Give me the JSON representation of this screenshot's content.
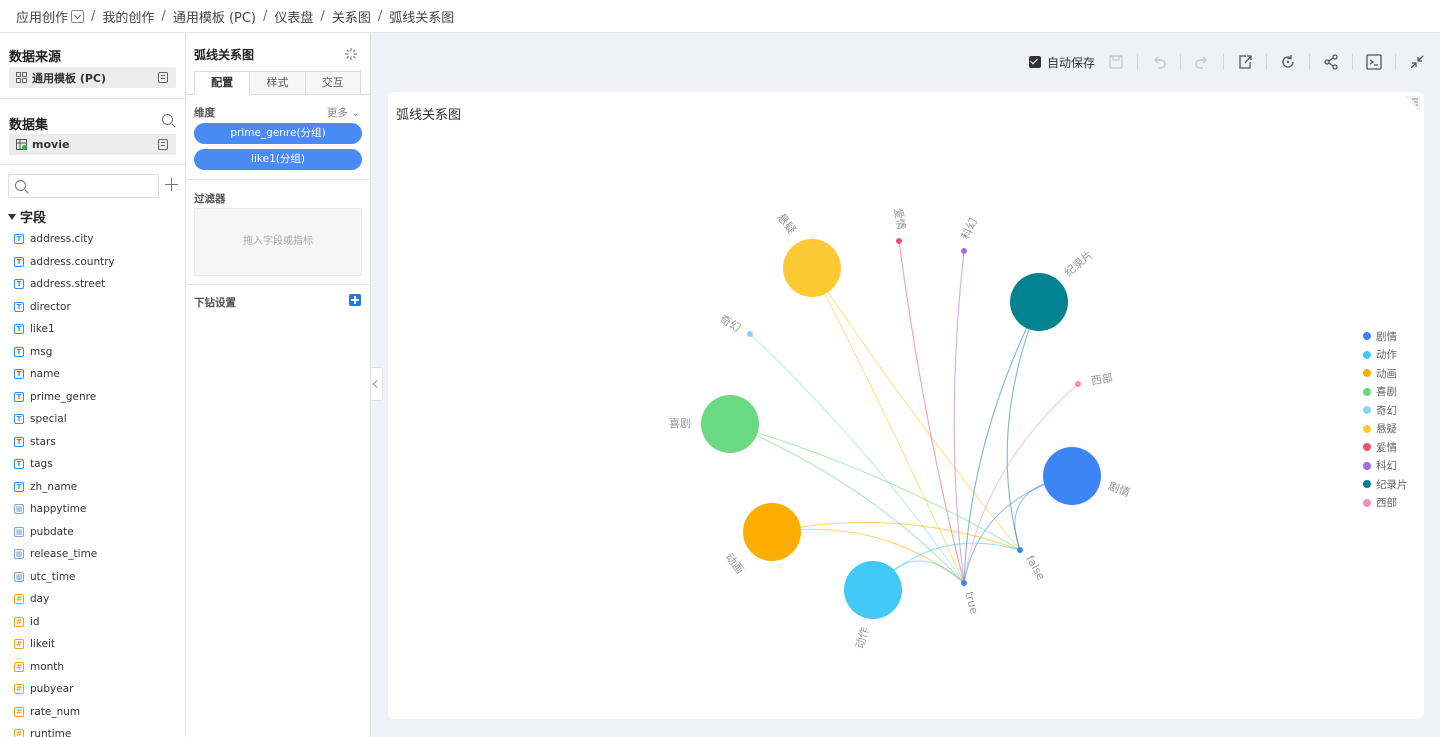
{
  "breadcrumb": {
    "items": [
      "应用创作",
      "我的创作",
      "通用模板 (PC)",
      "仪表盘",
      "关系图",
      "弧线关系图"
    ]
  },
  "left": {
    "datasource_title": "数据来源",
    "datasource_name": "通用模板 (PC)",
    "dataset_title": "数据集",
    "dataset_name": "movie",
    "search_placeholder": "",
    "fields_title": "字段",
    "fields": [
      {
        "name": "address.city",
        "type": "text"
      },
      {
        "name": "address.country",
        "type": "text"
      },
      {
        "name": "address.street",
        "type": "text"
      },
      {
        "name": "director",
        "type": "text"
      },
      {
        "name": "like1",
        "type": "text"
      },
      {
        "name": "msg",
        "type": "text"
      },
      {
        "name": "name",
        "type": "text"
      },
      {
        "name": "prime_genre",
        "type": "text"
      },
      {
        "name": "special",
        "type": "text"
      },
      {
        "name": "stars",
        "type": "text"
      },
      {
        "name": "tags",
        "type": "text"
      },
      {
        "name": "zh_name",
        "type": "text"
      },
      {
        "name": "happytime",
        "type": "date"
      },
      {
        "name": "pubdate",
        "type": "date"
      },
      {
        "name": "release_time",
        "type": "date"
      },
      {
        "name": "utc_time",
        "type": "date"
      },
      {
        "name": "day",
        "type": "number"
      },
      {
        "name": "id",
        "type": "number"
      },
      {
        "name": "likeit",
        "type": "number"
      },
      {
        "name": "month",
        "type": "number"
      },
      {
        "name": "pubyear",
        "type": "number"
      },
      {
        "name": "rate_num",
        "type": "number"
      },
      {
        "name": "runtime",
        "type": "number"
      }
    ]
  },
  "config": {
    "title": "弧线关系图",
    "tabs": [
      "配置",
      "样式",
      "交互"
    ],
    "dimension_label": "维度",
    "more_label": "更多",
    "dimensions": [
      "prime_genre(分组)",
      "like1(分组)"
    ],
    "filter_label": "过滤器",
    "filter_drop_hint": "拖入字段或指标",
    "drill_label": "下钻设置"
  },
  "toolbar": {
    "autosave_label": "自动保存",
    "autosave_checked": true
  },
  "chart": {
    "title": "弧线关系图"
  },
  "chart_data": {
    "type": "arc-relationship",
    "nodes": [
      {
        "name": "悬疑",
        "group": "prime_genre",
        "size": "large",
        "color": "#fcc934"
      },
      {
        "name": "爱情",
        "group": "prime_genre",
        "size": "small",
        "color": "#f0506e"
      },
      {
        "name": "科幻",
        "group": "prime_genre",
        "size": "small",
        "color": "#a56ce3"
      },
      {
        "name": "纪录片",
        "group": "prime_genre",
        "size": "large",
        "color": "#038391"
      },
      {
        "name": "奇幻",
        "group": "prime_genre",
        "size": "small",
        "color": "#8dd4f3"
      },
      {
        "name": "西部",
        "group": "prime_genre",
        "size": "small",
        "color": "#f78fbd"
      },
      {
        "name": "喜剧",
        "group": "prime_genre",
        "size": "large",
        "color": "#6bd983"
      },
      {
        "name": "剧情",
        "group": "prime_genre",
        "size": "large",
        "color": "#3d85f5"
      },
      {
        "name": "动画",
        "group": "prime_genre",
        "size": "large",
        "color": "#fbae00"
      },
      {
        "name": "动作",
        "group": "prime_genre",
        "size": "large",
        "color": "#42c9f5"
      },
      {
        "name": "true",
        "group": "like1",
        "size": "small",
        "color": "#3d85f5"
      },
      {
        "name": "false",
        "group": "like1",
        "size": "small",
        "color": "#3d85f5"
      }
    ],
    "links": [
      [
        "悬疑",
        "true"
      ],
      [
        "悬疑",
        "false"
      ],
      [
        "爱情",
        "true"
      ],
      [
        "科幻",
        "true"
      ],
      [
        "纪录片",
        "true"
      ],
      [
        "纪录片",
        "false"
      ],
      [
        "奇幻",
        "true"
      ],
      [
        "西部",
        "true"
      ],
      [
        "喜剧",
        "true"
      ],
      [
        "喜剧",
        "false"
      ],
      [
        "剧情",
        "true"
      ],
      [
        "剧情",
        "false"
      ],
      [
        "动画",
        "true"
      ],
      [
        "动画",
        "false"
      ],
      [
        "动作",
        "true"
      ],
      [
        "动作",
        "false"
      ]
    ],
    "legend": {
      "position": "right",
      "entries": [
        {
          "name": "剧情",
          "color": "#3d85f5"
        },
        {
          "name": "动作",
          "color": "#42c9f5"
        },
        {
          "name": "动画",
          "color": "#fbae00"
        },
        {
          "name": "喜剧",
          "color": "#6bd983"
        },
        {
          "name": "奇幻",
          "color": "#8dd4f3"
        },
        {
          "name": "悬疑",
          "color": "#fcc934"
        },
        {
          "name": "爱情",
          "color": "#f0506e"
        },
        {
          "name": "科幻",
          "color": "#a56ce3"
        },
        {
          "name": "纪录片",
          "color": "#038391"
        },
        {
          "name": "西部",
          "color": "#f78fbd"
        }
      ]
    }
  }
}
